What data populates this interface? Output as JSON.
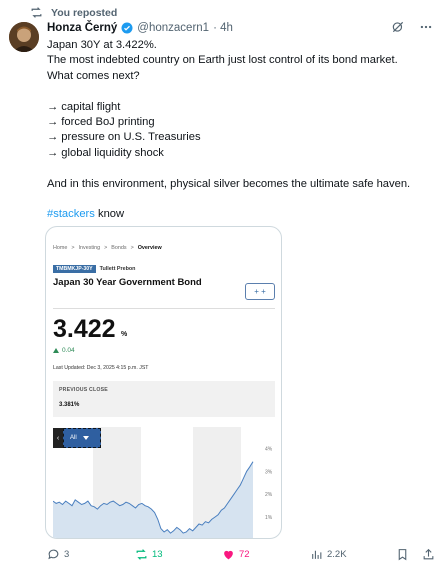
{
  "repost": {
    "label": "You reposted"
  },
  "author": {
    "name": "Honza Černý",
    "handle": "@honzacern1",
    "time": "· 4h"
  },
  "tweet": {
    "lines": [
      "Japan 30Y at 3.422%.",
      "The most indebted country on Earth just lost control of its bond market.",
      "What comes next?",
      "",
      "→ capital flight",
      "→ forced BoJ printing",
      "→ pressure on U.S. Treasuries",
      "→ global liquidity shock",
      "",
      "And in this environment, physical silver becomes the ultimate safe haven.",
      ""
    ],
    "hashtag": "#stackers",
    "after_hashtag": " know"
  },
  "card": {
    "breadcrumbs": [
      "Home",
      ">",
      "Investing",
      ">",
      "Bonds",
      ">",
      "Overview"
    ],
    "ticker": "TMBMKJP-30Y",
    "provider": "Tullett Prebon",
    "title": "Japan 30 Year Government Bond",
    "plus_button": "+ +",
    "value": "3.422",
    "unit": "%",
    "change": "0.04",
    "updated": "Last Updated: Dec 3, 2025 4:15 p.m. JST",
    "previous_close_label": "PREVIOUS CLOSE",
    "previous_close_value": "3.381%",
    "range_control": "All",
    "y_ticks": [
      "4%",
      "3%",
      "2%",
      "1%"
    ]
  },
  "actions": {
    "replies": "3",
    "reposts": "13",
    "likes": "72",
    "views": "2.2K"
  },
  "colors": {
    "accent": "#1d9bf0",
    "repost_active": "#00ba7c",
    "like_active": "#f91880",
    "chart_line": "#4a7fbf",
    "chart_fill": "#d6e3f0"
  },
  "chart_data": {
    "type": "area",
    "ylim": [
      0,
      4.5
    ],
    "y_ticks": [
      "4%",
      "3%",
      "2%",
      "1%"
    ],
    "values": [
      1.7,
      1.6,
      1.65,
      1.55,
      1.7,
      1.6,
      1.5,
      1.75,
      1.65,
      1.55,
      1.6,
      1.7,
      1.5,
      1.45,
      1.35,
      1.5,
      1.6,
      1.55,
      1.65,
      1.7,
      1.6,
      1.5,
      1.55,
      1.65,
      1.6,
      1.5,
      1.4,
      1.55,
      1.6,
      1.5,
      1.45,
      1.35,
      1.2,
      0.9,
      0.5,
      0.35,
      0.45,
      0.3,
      0.4,
      0.55,
      0.45,
      0.3,
      0.35,
      0.5,
      0.4,
      0.55,
      0.7,
      0.65,
      0.8,
      0.75,
      0.9,
      1.0,
      1.1,
      1.3,
      1.4,
      1.6,
      1.8,
      2.0,
      2.2,
      2.4,
      2.7,
      3.0,
      3.2,
      3.42
    ]
  }
}
